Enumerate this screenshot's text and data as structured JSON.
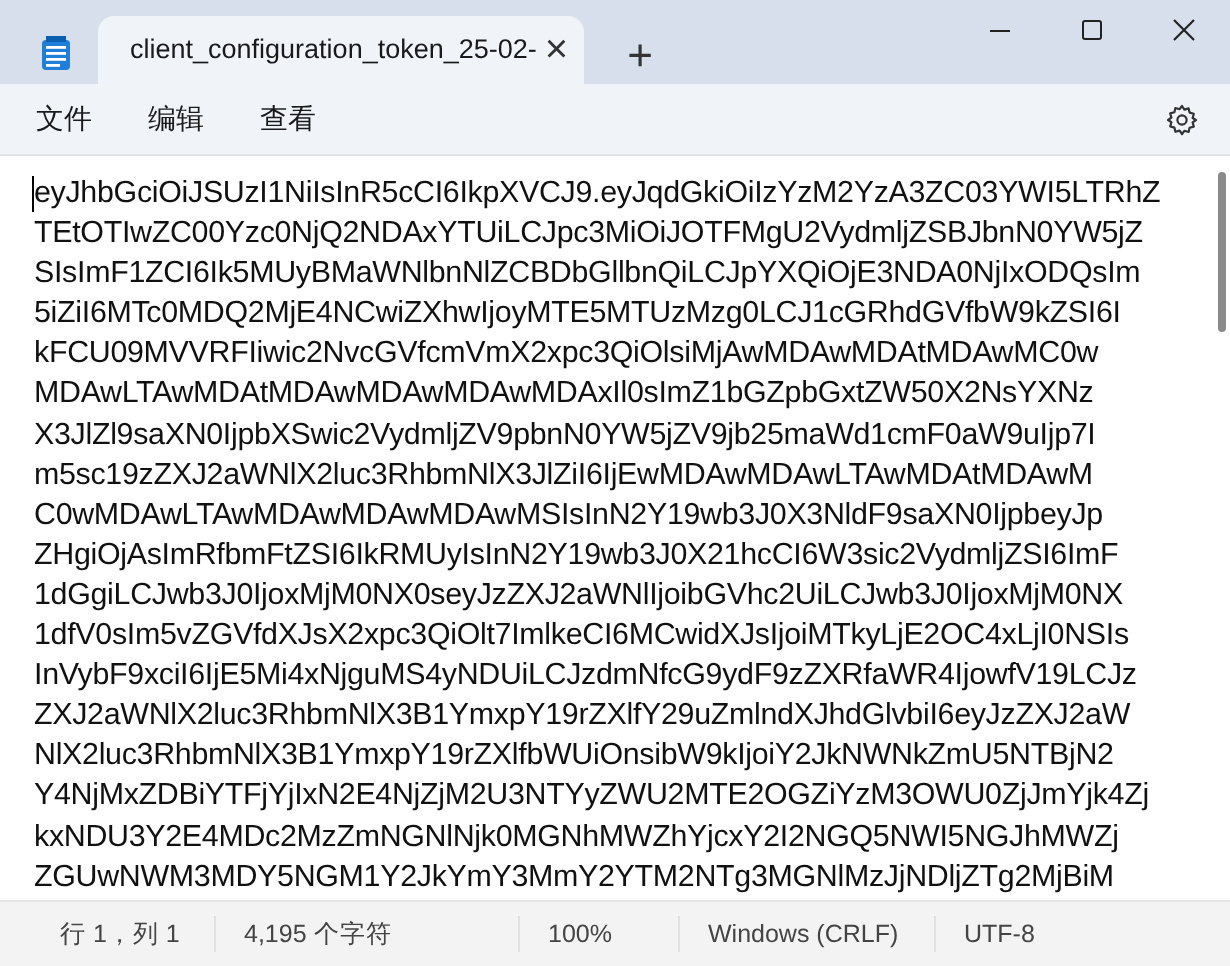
{
  "tabs": [
    {
      "title": "client_configuration_token_25-02-",
      "selected": true,
      "close": "×"
    }
  ],
  "new_tab": "+",
  "menu": [
    "文件",
    "编辑",
    "查看"
  ],
  "editor": {
    "lines": [
      "eyJhbGciOiJSUzI1NiIsInR5cCI6IkpXVCJ9.eyJqdGkiOiIzYzM2YzA3ZC03YWI5LTRhZ",
      "TEtOTIwZC00Yzc0NjQ2NDAxYTUiLCJpc3MiOiJOTFMgU2VydmljZSBJbnN0YW5jZ",
      "SIsImF1ZCI6Ik5MUyBMaWNlbnNlZCBDbGllbnQiLCJpYXQiOjE3NDA0NjIxODQsIm",
      "5iZiI6MTc0MDQ2MjE4NCwiZXhwIjoyMTE5MTUzMzg0LCJ1cGRhdGVfbW9kZSI6I",
      "kFCU09MVVRFIiwic2NvcGVfcmVmX2xpc3QiOlsiMjAwMDAwMDAtMDAwMC0w",
      "MDAwLTAwMDAtMDAwMDAwMDAwMDAxIl0sImZ1bGZpbGxtZW50X2NsYXNz",
      "X3JlZl9saXN0IjpbXSwic2VydmljZV9pbnN0YW5jZV9jb25maWd1cmF0aW9uIjp7I",
      "m5sc19zZXJ2aWNlX2luc3RhbmNlX3JlZiI6IjEwMDAwMDAwLTAwMDAtMDAwM",
      "C0wMDAwLTAwMDAwMDAwMDAwMSIsInN2Y19wb3J0X3NldF9saXN0IjpbeyJp",
      "ZHgiOjAsImRfbmFtZSI6IkRMUyIsInN2Y19wb3J0X21hcCI6W3sic2VydmljZSI6ImF",
      "1dGgiLCJwb3J0IjoxMjM0NX0seyJzZXJ2aWNlIjoibGVhc2UiLCJwb3J0IjoxMjM0NX",
      "1dfV0sIm5vZGVfdXJsX2xpc3QiOlt7ImlkeCI6MCwidXJsIjoiMTkyLjE2OC4xLjI0NSIs",
      "InVybF9xciI6IjE5Mi4xNjguMS4yNDUiLCJzdmNfcG9ydF9zZXRfaWR4IjowfV19LCJz",
      "ZXJ2aWNlX2luc3RhbmNlX3B1YmxpY19rZXlfY29uZmlndXJhdGlvbiI6eyJzZXJ2aW",
      "NlX2luc3RhbmNlX3B1YmxpY19rZXlfbWUiOnsibW9kIjoiY2JkNWNkZmU5NTBjN2",
      "Y4NjMxZDBiYTFjYjIxN2E4NjZjM2U3NTYyZWU2MTE2OGZiYzM3OWU0ZjJmYjk4Zj",
      "kxNDU3Y2E4MDc2MzZmNGNlNjk0MGNhMWZhYjcxY2I2NGQ5NWI5NGJhMWZj",
      "ZGUwNWM3MDY5NGM1Y2JkYmY3MmY2YTM2NTg3MGNlMzJjNDljZTg2MjBiM"
    ]
  },
  "status_bar": [
    "行 1，列 1",
    "4,195 个字符",
    "100%",
    "Windows (CRLF)",
    "UTF-8"
  ]
}
